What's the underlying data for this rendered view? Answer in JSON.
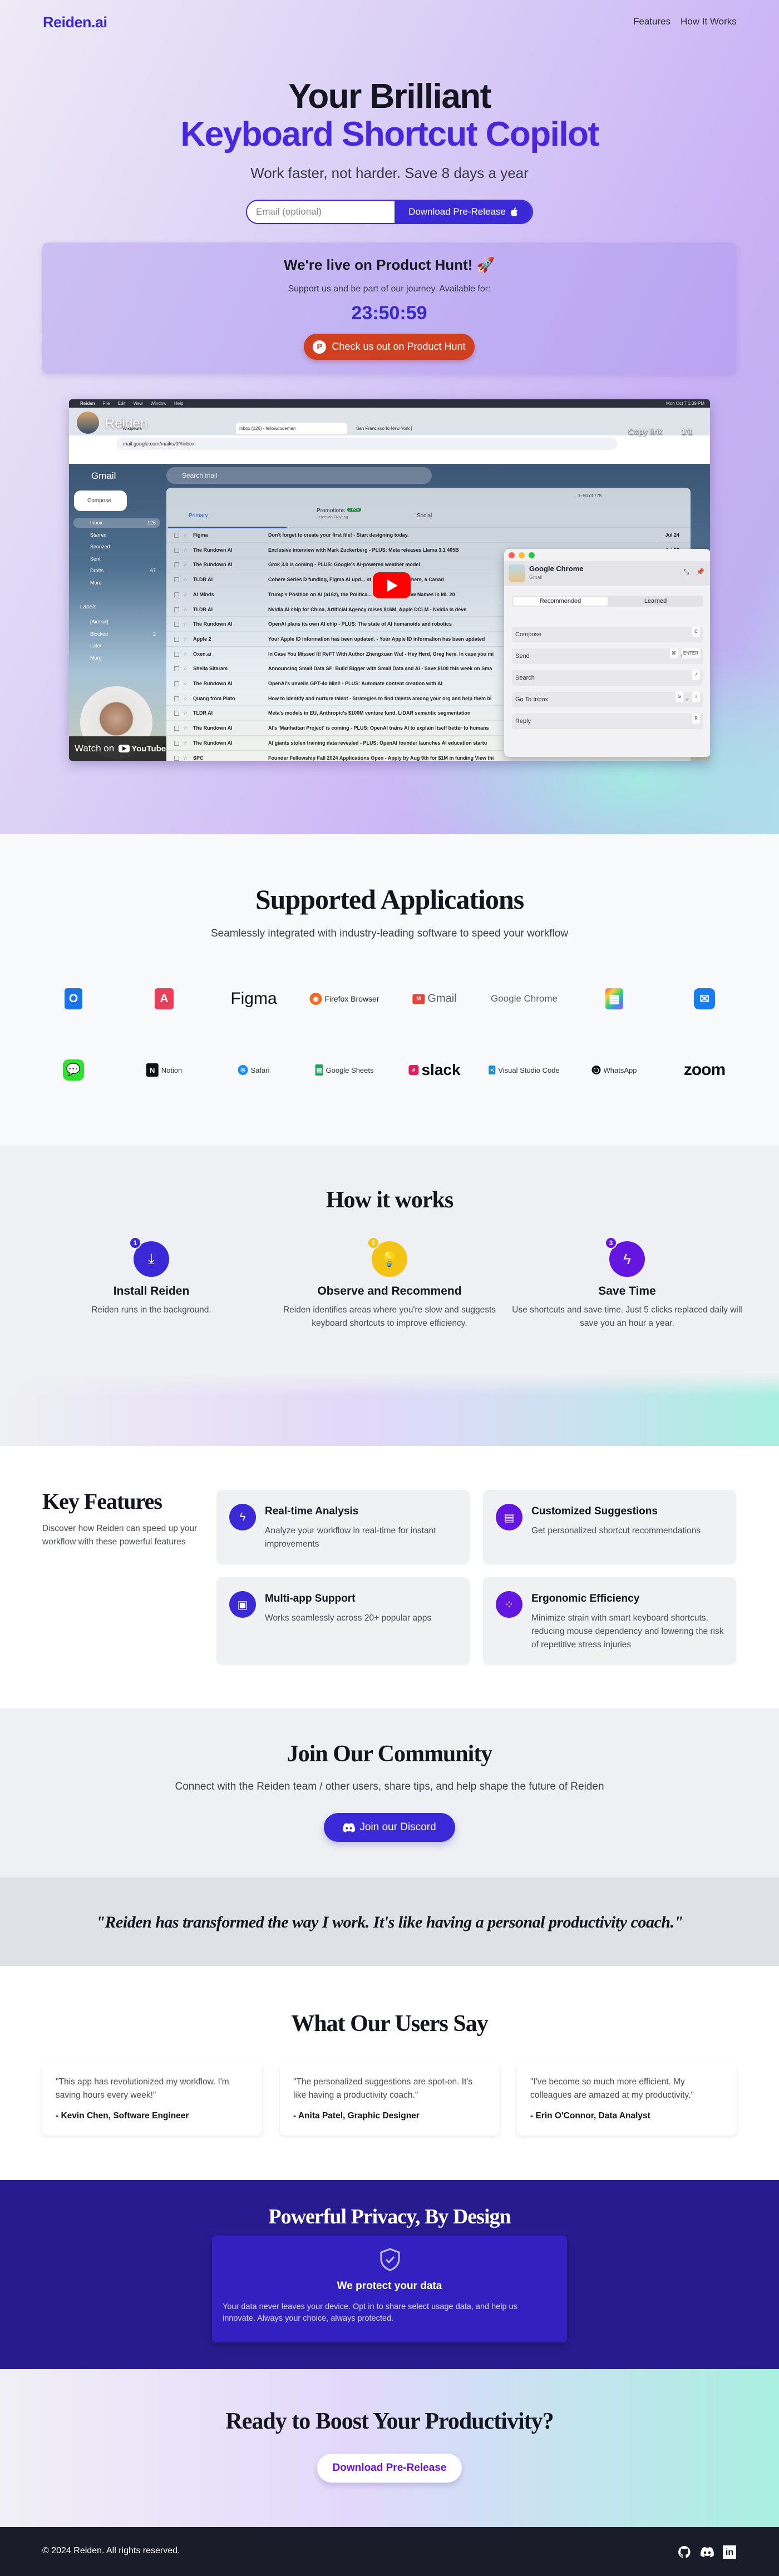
{
  "nav": {
    "logo": "Reiden.ai",
    "links": [
      "Features",
      "How It Works"
    ]
  },
  "hero": {
    "title_line1": "Your Brilliant",
    "title_line2": "Keyboard Shortcut Copilot",
    "subtitle": "Work faster, not harder. Save 8 days a year",
    "email_placeholder": "Email (optional)",
    "download_label": "Download Pre-Release",
    "download_icon": "apple-icon"
  },
  "product_hunt": {
    "heading": "We're live on Product Hunt! 🚀",
    "text": "Support us and be part of our journey. Available for:",
    "countdown": "23:50:59",
    "button_label": "Check us out on Product Hunt",
    "button_color": "#cf3f20"
  },
  "video": {
    "channel_title": "Reiden",
    "copy_link": "Copy link",
    "playlist_count": "1/1",
    "watch_on": "Watch on",
    "youtube": "YouTube",
    "menubar": [
      "Reiden",
      "File",
      "Edit",
      "View",
      "Window",
      "Help"
    ],
    "clock": "Mon Oct 7 1:39 PM",
    "browser_tabs": [
      "Wikipedia",
      "Inbox (126) - fellowdudeman",
      "San Francisco to New York |"
    ],
    "url": "mail.google.com/mail/u/0/#inbox",
    "gmail": {
      "logo": "Gmail",
      "search_placeholder": "Search mail",
      "compose": "Compose",
      "sidebar": [
        {
          "label": "Inbox",
          "count": "125"
        },
        {
          "label": "Starred",
          "count": ""
        },
        {
          "label": "Snoozed",
          "count": ""
        },
        {
          "label": "Sent",
          "count": ""
        },
        {
          "label": "Drafts",
          "count": "67"
        },
        {
          "label": "More",
          "count": ""
        }
      ],
      "labels_heading": "Labels",
      "labels": [
        {
          "label": "[Airmail]",
          "count": ""
        },
        {
          "label": "Blocked",
          "count": "2"
        },
        {
          "label": "Later",
          "count": ""
        },
        {
          "label": "More",
          "count": ""
        }
      ],
      "pagination": "1–50 of 778",
      "tabs": [
        "Primary",
        "Promotions",
        "Social"
      ],
      "promotions_badge": "1 new",
      "promotions_sub": "Jeremiah Owyang",
      "rows": [
        {
          "sender": "Figma",
          "subject": "Don't forget to create your first file! - Start designing today.",
          "date": "Jul 24"
        },
        {
          "sender": "The Rundown AI",
          "subject": "Exclusive interview with Mark Zuckerberg - PLUS: Meta releases Llama 3.1 405B",
          "date": "Jul 23"
        },
        {
          "sender": "The Rundown AI",
          "subject": "Grok 3.0 is coming - PLUS: Google's AI-powered weather model",
          "date": ""
        },
        {
          "sender": "TLDR AI",
          "subject": "Cohere Series D funding, Figma AI upd... nt Benchmark - Cohere, a Canad",
          "date": ""
        },
        {
          "sender": "AI Minds",
          "subject": "Trump's Position on AI (a16z), the Politica... s, and Must-Know Names in ML 20",
          "date": ""
        },
        {
          "sender": "TLDR AI",
          "subject": "Nvidia AI chip for China, Artificial Agency raises $16M, Apple DCLM - Nvidia is deve",
          "date": ""
        },
        {
          "sender": "The Rundown AI",
          "subject": "OpenAI plans its own AI chip - PLUS: The state of AI humanoids and robotics",
          "date": ""
        },
        {
          "sender": "Apple 2",
          "subject": "Your Apple ID information has been updated. - Your Apple ID information has been updated",
          "date": ""
        },
        {
          "sender": "Oxen.ai",
          "subject": "In Case You Missed It! ReFT With Author Zhengxuan Wu! - Hey Herd, Greg here. In case you mi",
          "date": ""
        },
        {
          "sender": "Sheila Sitaram",
          "subject": "Announcing Small Data SF: Build Bigger with Small Data and AI - Save $100 this week on Sma",
          "date": ""
        },
        {
          "sender": "The Rundown AI",
          "subject": "OpenAI's unveils GPT-4o Mini! - PLUS: Automate content creation with AI",
          "date": ""
        },
        {
          "sender": "Quang from Plato",
          "subject": "How to identify and nurture talent - Strategies to find talents among your org and help them bl",
          "date": ""
        },
        {
          "sender": "TLDR AI",
          "subject": "Meta's models in EU, Anthropic's $100M venture fund, LiDAR semantic segmentation",
          "date": ""
        },
        {
          "sender": "The Rundown AI",
          "subject": "AI's 'Manhattan Project' is coming - PLUS: OpenAI trains AI to explain itself better to humans",
          "date": ""
        },
        {
          "sender": "The Rundown AI",
          "subject": "AI giants stolen training data revealed - PLUS: OpenAI founder launches AI education startu",
          "date": ""
        },
        {
          "sender": "SPC",
          "subject": "Founder Fellowship Fall 2024 Applications Open - Apply by Aug 9th for $1M in funding View thi",
          "date": ""
        }
      ]
    },
    "reiden_panel": {
      "app_name": "Google Chrome",
      "context": "Gmail",
      "tabs": [
        "Recommended",
        "Learned"
      ],
      "shortcuts": [
        {
          "name": "Compose",
          "keys": [
            "C"
          ]
        },
        {
          "name": "Send",
          "keys": [
            "⌘",
            "+",
            "ENTER"
          ]
        },
        {
          "name": "Search",
          "keys": [
            "/"
          ]
        },
        {
          "name": "Go To Inbox",
          "keys": [
            "G",
            "+",
            "I"
          ]
        },
        {
          "name": "Reply",
          "keys": [
            "R"
          ]
        }
      ]
    }
  },
  "apps": {
    "title": "Supported Applications",
    "subtitle": "Seamlessly integrated with industry-leading software to speed your workflow",
    "row1": [
      {
        "icon": "outlook-icon",
        "label": ""
      },
      {
        "icon": "arc-icon",
        "label": ""
      },
      {
        "icon": "figma-icon",
        "label": "Figma"
      },
      {
        "icon": "firefox-icon",
        "label": "Firefox Browser"
      },
      {
        "icon": "gmail-icon",
        "label": "Gmail"
      },
      {
        "icon": "chrome-icon",
        "label": "Google Chrome"
      },
      {
        "icon": "final-cut-pro-icon",
        "label": ""
      },
      {
        "icon": "mail-icon",
        "label": ""
      }
    ],
    "row2": [
      {
        "icon": "messages-icon",
        "label": ""
      },
      {
        "icon": "notion-icon",
        "label": "Notion"
      },
      {
        "icon": "safari-icon",
        "label": "Safari"
      },
      {
        "icon": "google-sheets-icon",
        "label": "Google Sheets"
      },
      {
        "icon": "slack-icon",
        "label": "slack"
      },
      {
        "icon": "vscode-icon",
        "label": "Visual Studio Code"
      },
      {
        "icon": "whatsapp-icon",
        "label": "WhatsApp"
      },
      {
        "icon": "zoom-icon",
        "label": "zoom"
      }
    ]
  },
  "how": {
    "title": "How it works",
    "steps": [
      {
        "num": "1",
        "title": "Install Reiden",
        "desc": "Reiden runs in the background.",
        "icon": "download-icon",
        "color": "#3b28d6"
      },
      {
        "num": "2",
        "title": "Observe and Recommend",
        "desc": "Reiden identifies areas where you're slow and suggests keyboard shortcuts to improve efficiency.",
        "icon": "lightbulb-icon",
        "color": "#f3c316"
      },
      {
        "num": "3",
        "title": "Save Time",
        "desc": "Use shortcuts and save time. Just 5 clicks replaced daily will save you an hour a year.",
        "icon": "lightning-icon",
        "color": "#6415e0"
      }
    ]
  },
  "features": {
    "title": "Key Features",
    "desc": "Discover how Reiden can speed up your workflow with these powerful features",
    "items": [
      {
        "title": "Real-time Analysis",
        "desc": "Analyze your workflow in real-time for instant improvements",
        "icon": "lightning-icon"
      },
      {
        "title": "Customized Suggestions",
        "desc": "Get personalized shortcut recommendations",
        "icon": "clipboard-list-icon"
      },
      {
        "title": "Multi-app Support",
        "desc": "Works seamlessly across 20+ popular apps",
        "icon": "cpu-icon"
      },
      {
        "title": "Ergonomic Efficiency",
        "desc": "Minimize strain with smart keyboard shortcuts, reducing mouse dependency and lowering the risk of repetitive stress injuries",
        "icon": "qr-grid-icon"
      }
    ]
  },
  "community": {
    "title": "Join Our Community",
    "subtitle": "Connect with the Reiden team / other users, share tips, and help shape the future of Reiden",
    "button": "Join our Discord"
  },
  "quote": "\"Reiden has transformed the way I work. It's like having a personal productivity coach.\"",
  "testimonials": {
    "title": "What Our Users Say",
    "items": [
      {
        "quote": "\"This app has revolutionized my workflow. I'm saving hours every week!\"",
        "author": "- Kevin Chen, Software Engineer"
      },
      {
        "quote": "\"The personalized suggestions are spot-on. It's like having a productivity coach.\"",
        "author": "- Anita Patel, Graphic Designer"
      },
      {
        "quote": "\"I've become so much more efficient. My colleagues are amazed at my productivity.\"",
        "author": "- Erin O'Connor, Data Analyst"
      }
    ]
  },
  "privacy": {
    "title": "Powerful Privacy, By Design",
    "card_title": "We protect your data",
    "card_text": "Your data never leaves your device. Opt in to share select usage data, and help us innovate. Always your choice, always protected."
  },
  "cta": {
    "title": "Ready to Boost Your Productivity?",
    "button": "Download Pre-Release"
  },
  "footer": {
    "copyright": "© 2024 Reiden. All rights reserved.",
    "icons": [
      "github-icon",
      "discord-icon",
      "linkedin-icon"
    ]
  },
  "colors": {
    "primary": "#3b28d6",
    "title_accent": "#4a26dc",
    "privacy_bg": "#281b8f",
    "footer_bg": "#1a1d29"
  }
}
